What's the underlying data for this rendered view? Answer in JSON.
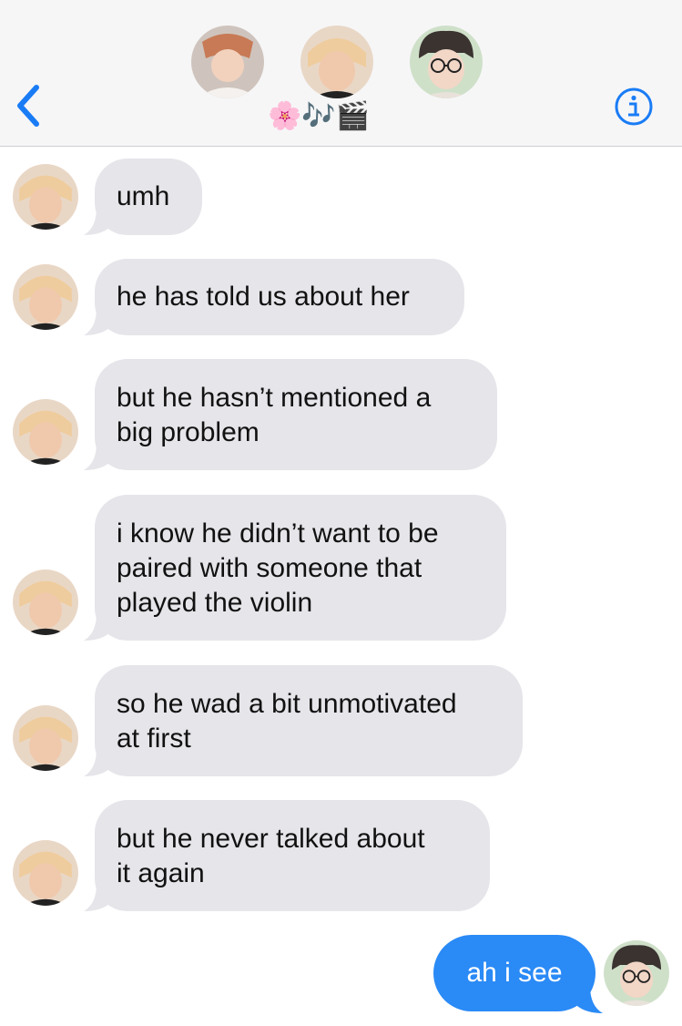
{
  "header": {
    "title_emoji": "🌸🎶🎬",
    "participants": [
      "participant-1",
      "participant-2",
      "participant-3"
    ]
  },
  "messages": [
    {
      "lines": [
        "umh"
      ]
    },
    {
      "lines": [
        "he has told us about her"
      ]
    },
    {
      "lines": [
        "but he hasn’t mentioned a",
        "big problem"
      ]
    },
    {
      "lines": [
        "i know he didn’t want to be",
        "paired with someone that",
        "played the violin"
      ]
    },
    {
      "lines": [
        "so he wad a bit unmotivated",
        "at first"
      ]
    },
    {
      "lines": [
        "but he never talked about",
        "it again"
      ]
    }
  ],
  "sent_message": {
    "text": "ah i see"
  },
  "colors": {
    "header_bg": "#f6f6f7",
    "received_bubble": "#e5e5ea",
    "sent_bubble": "#2a8af6",
    "accent": "#1a7cf5"
  },
  "icons": {
    "back": "chevron-left-icon",
    "info": "info-icon"
  }
}
